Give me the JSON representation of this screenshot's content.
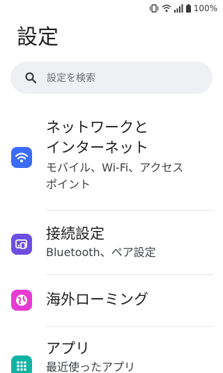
{
  "status_bar": {
    "battery": "100%"
  },
  "header": {
    "title": "設定"
  },
  "search": {
    "placeholder": "設定を検索"
  },
  "settings_items": [
    {
      "title_line1": "ネットワークと",
      "title_line2": "インターネット",
      "subtitle_line1": "モバイル、Wi-Fi、アクセス",
      "subtitle_line2": "ポイント",
      "icon": "wifi-icon",
      "color": "#3b6cf6"
    },
    {
      "title": "接続設定",
      "subtitle": "Bluetooth、ペア設定",
      "icon": "connected-devices-icon",
      "color": "#6c4fe0"
    },
    {
      "title": "海外ローミング",
      "icon": "globe-icon",
      "color": "#e63bd1"
    },
    {
      "title": "アプリ",
      "subtitle": "最近使ったアプリ",
      "icon": "apps-icon",
      "color": "#11b3a3"
    }
  ]
}
